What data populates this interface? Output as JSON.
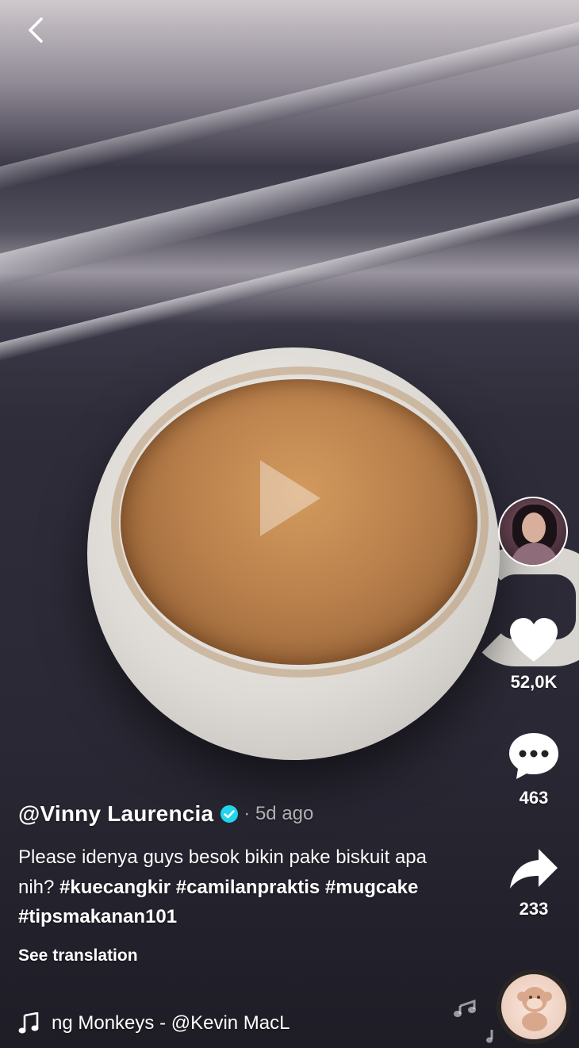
{
  "post": {
    "username": "@Vinny Laurencia",
    "time_ago": "· 5d ago",
    "description_text": "Please idenya guys besok bikin pake biskuit apa nih?",
    "hashtags": [
      "#kuecangkir",
      "#camilanpraktis",
      "#mugcake",
      "#tipsmakanan101"
    ],
    "see_translation": "See translation",
    "music": "ng Monkeys - @Kevin MacL"
  },
  "actions": {
    "likes": "52,0K",
    "comments": "463",
    "shares": "233"
  },
  "icons": {
    "back": "chevron-left-icon",
    "play": "play-icon",
    "verified": "verified-badge-icon",
    "like": "heart-icon",
    "comment": "comment-bubble-icon",
    "share": "share-arrow-icon",
    "music": "music-note-icon"
  },
  "colors": {
    "verified": "#20d5ec",
    "text": "#ffffff"
  }
}
